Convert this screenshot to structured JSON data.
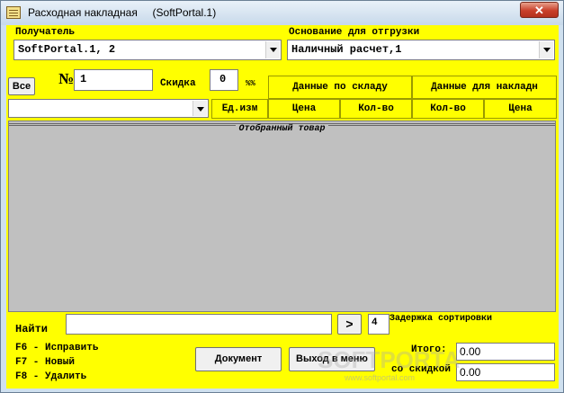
{
  "window": {
    "title": "Расходная накладная     (SoftPortal.1)",
    "close_glyph": "✕"
  },
  "recipient": {
    "label": "Получатель",
    "value": "SoftPortal.1, 2"
  },
  "shipment_basis": {
    "label": "Основание для отгрузки",
    "value": "Наличный расчет,1"
  },
  "all_button": "Все",
  "number": {
    "label": "№",
    "value": "1"
  },
  "discount": {
    "label": "Скидка",
    "value": "0",
    "unit": "%%"
  },
  "unit_header": "Ед.изм",
  "warehouse": {
    "header": "Данные по складу",
    "price": "Цена",
    "qty": "Кол-во"
  },
  "invoice": {
    "header": "Данные для накладн",
    "qty": "Кол-во",
    "price": "Цена"
  },
  "goods_filter": {
    "value": ""
  },
  "grid": {
    "caption": "Отобранный товар"
  },
  "search": {
    "label": "Найти",
    "value": "",
    "go_button": ">",
    "delay_value": "4",
    "delay_label": "Задержка сортировки"
  },
  "hotkeys": [
    "F6 - Исправить",
    "F7 - Новый",
    "F8 - Удалить"
  ],
  "document_button": "Документ",
  "exit_button": "Выход в меню",
  "totals": {
    "total_label": "Итого:",
    "total_value": "0.00",
    "discount_label": "со скидкой",
    "discount_value": "0.00"
  },
  "colors": {
    "client_bg": "#ffff00",
    "grid_bg": "#c0c0c0",
    "close_button": "#c9402a"
  },
  "watermark": {
    "brand": "SOFTPORTAL",
    "url": "www.softportal.com"
  }
}
